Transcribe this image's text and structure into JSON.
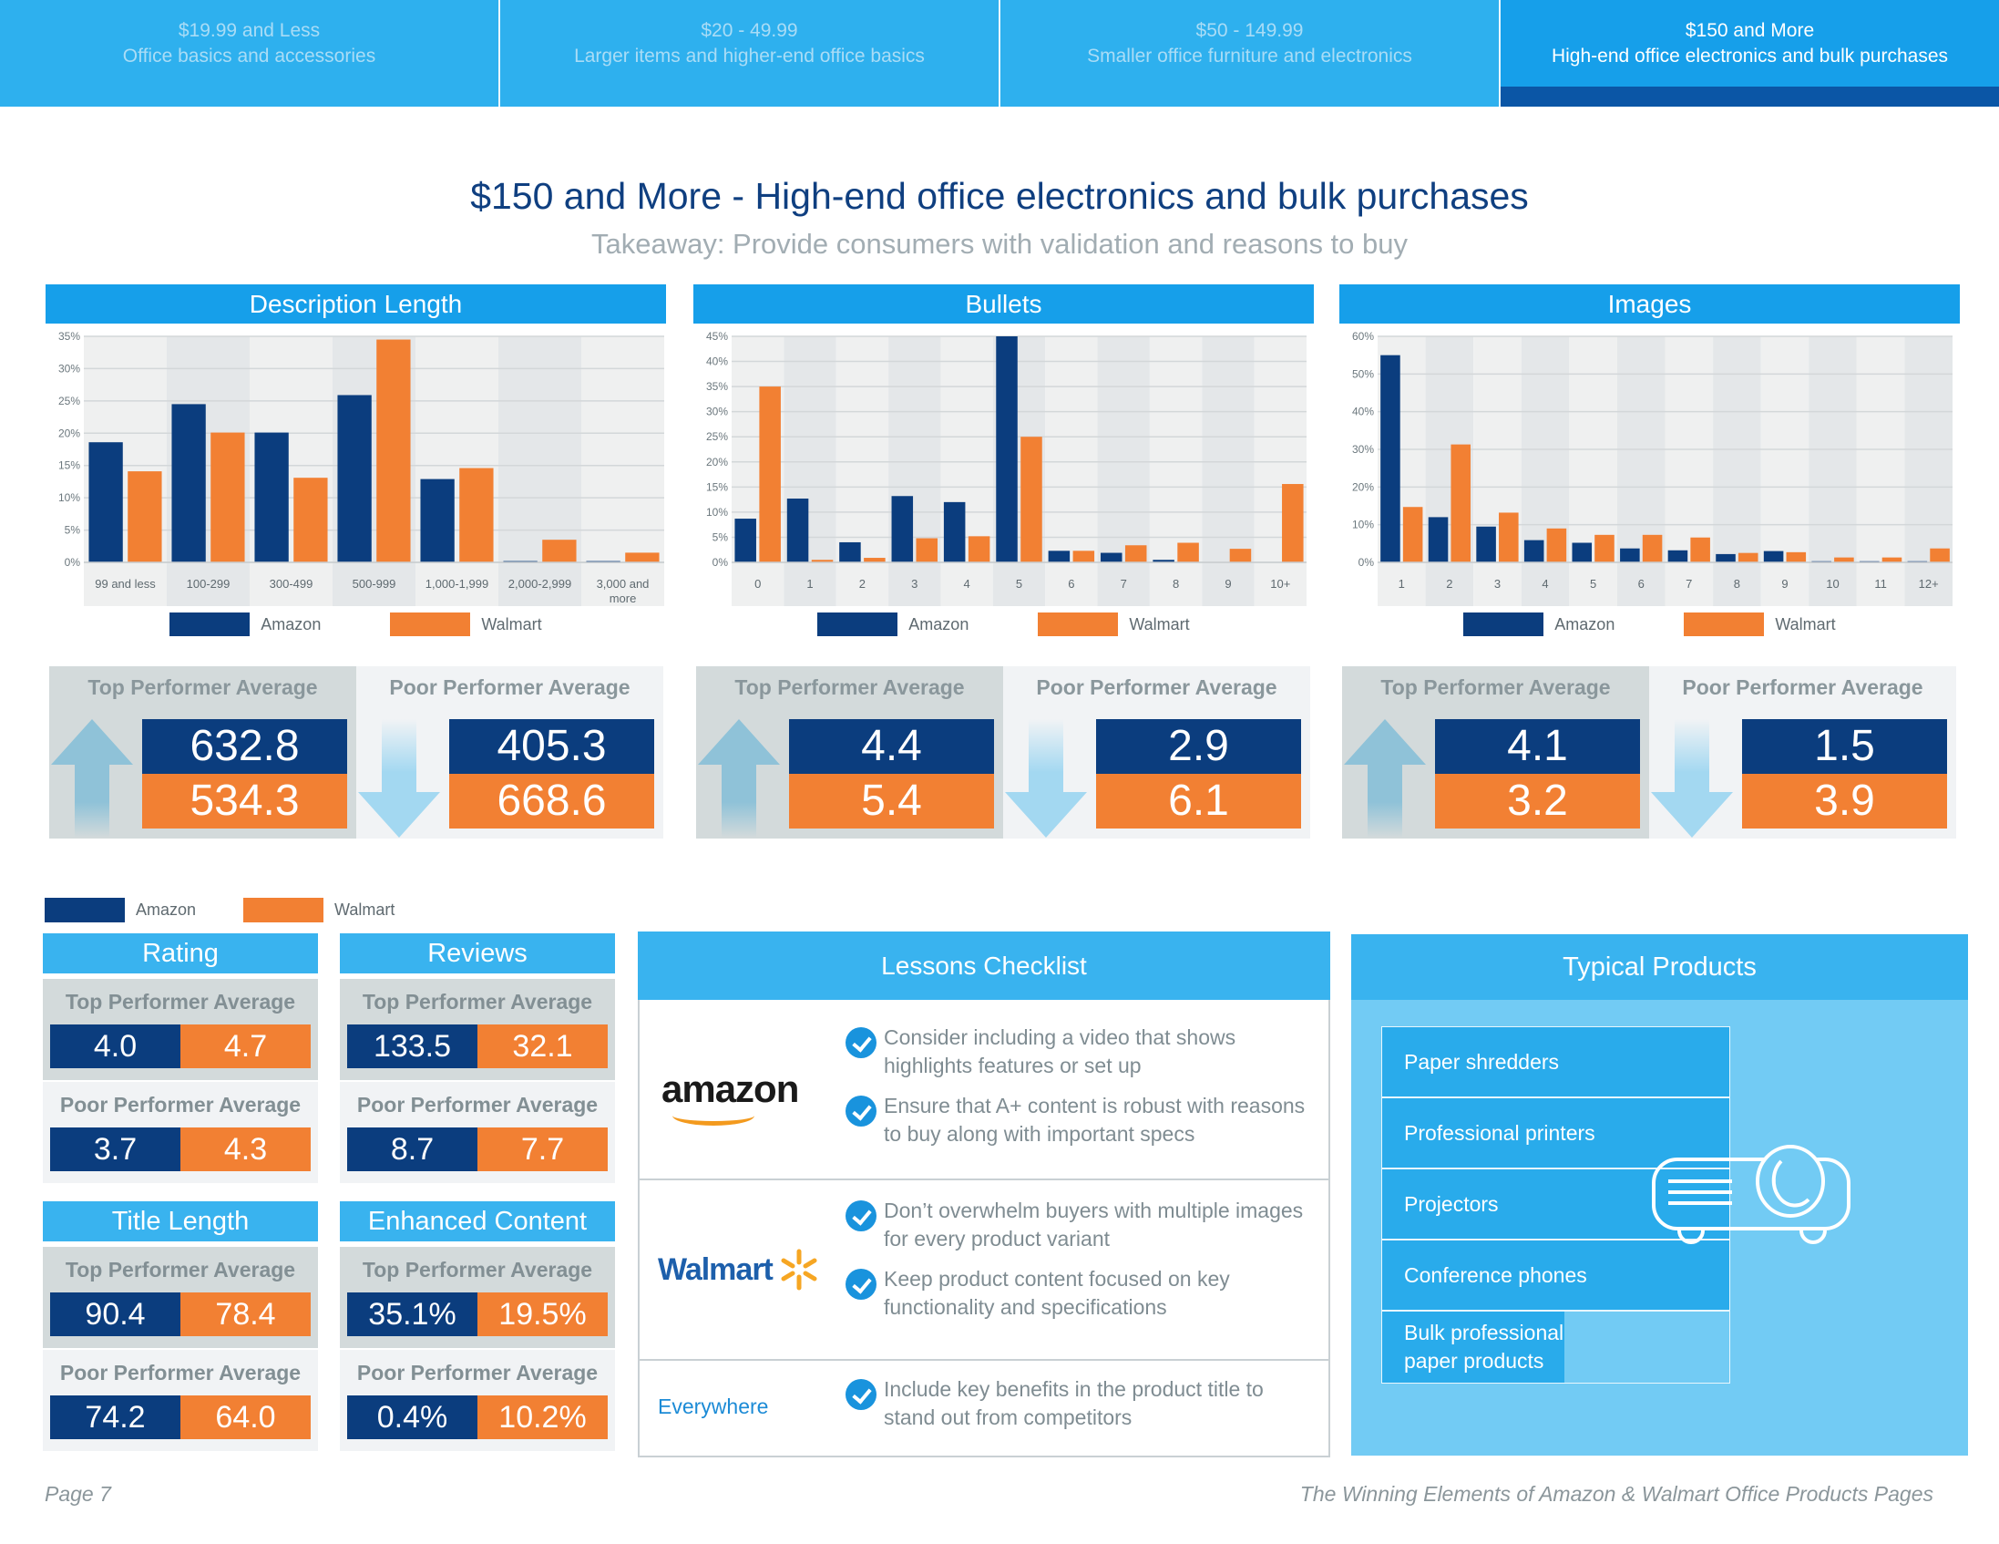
{
  "nav": {
    "tabs": [
      {
        "price": "$19.99 and Less",
        "desc": "Office basics and accessories",
        "active": false
      },
      {
        "price": "$20 - 49.99",
        "desc": "Larger items and higher-end office basics",
        "active": false
      },
      {
        "price": "$50 - 149.99",
        "desc": "Smaller office furniture and electronics",
        "active": false
      },
      {
        "price": "$150 and More",
        "desc": "High-end office electronics and bulk purchases",
        "active": true
      }
    ]
  },
  "header": {
    "title": "$150 and More - High-end office electronics and bulk purchases",
    "subtitle": "Takeaway: Provide consumers with validation and reasons to buy"
  },
  "colors": {
    "amazon": "#0b3d7e",
    "walmart": "#f28033",
    "accent": "#169fea"
  },
  "legend": {
    "amazon": "Amazon",
    "walmart": "Walmart"
  },
  "chart_data": [
    {
      "type": "bar",
      "title": "Description Length",
      "xlabel": "",
      "ylabel": "",
      "ylim": [
        0,
        35
      ],
      "yticks": [
        "0%",
        "5%",
        "10%",
        "15%",
        "20%",
        "25%",
        "30%",
        "35%"
      ],
      "ytick_values": [
        0,
        5,
        10,
        15,
        20,
        25,
        30,
        35
      ],
      "grid": true,
      "legend_position": "bottom",
      "categories": [
        "99 and less",
        "100-299",
        "300-499",
        "500-999",
        "1,000-1,999",
        "2,000-2,999",
        "3,000 and more"
      ],
      "series": [
        {
          "name": "Amazon",
          "values": [
            18.6,
            24.5,
            20.1,
            25.9,
            12.9,
            0.2,
            0.2
          ]
        },
        {
          "name": "Walmart",
          "values": [
            14.1,
            20.1,
            13.1,
            34.5,
            14.6,
            3.5,
            1.5
          ]
        }
      ]
    },
    {
      "type": "bar",
      "title": "Bullets",
      "xlabel": "",
      "ylabel": "",
      "ylim": [
        0,
        45
      ],
      "yticks": [
        "0%",
        "5%",
        "10%",
        "15%",
        "20%",
        "25%",
        "30%",
        "35%",
        "40%",
        "45%"
      ],
      "ytick_values": [
        0,
        5,
        10,
        15,
        20,
        25,
        30,
        35,
        40,
        45
      ],
      "grid": true,
      "legend_position": "bottom",
      "categories": [
        "0",
        "1",
        "2",
        "3",
        "4",
        "5",
        "6",
        "7",
        "8",
        "9",
        "10+"
      ],
      "series": [
        {
          "name": "Amazon",
          "values": [
            8.7,
            12.7,
            4.0,
            13.2,
            12.0,
            45.0,
            2.3,
            1.9,
            0.5,
            0.0,
            0.0
          ]
        },
        {
          "name": "Walmart",
          "values": [
            35.0,
            0.5,
            0.9,
            4.8,
            5.2,
            25.0,
            2.3,
            3.4,
            3.9,
            2.7,
            15.6
          ]
        }
      ]
    },
    {
      "type": "bar",
      "title": "Images",
      "xlabel": "",
      "ylabel": "",
      "ylim": [
        0,
        60
      ],
      "yticks": [
        "0%",
        "10%",
        "20%",
        "30%",
        "40%",
        "50%",
        "60%"
      ],
      "ytick_values": [
        0,
        10,
        20,
        30,
        40,
        50,
        60
      ],
      "grid": true,
      "legend_position": "bottom",
      "categories": [
        "1",
        "2",
        "3",
        "4",
        "5",
        "6",
        "7",
        "8",
        "9",
        "10",
        "11",
        "12+"
      ],
      "series": [
        {
          "name": "Amazon",
          "values": [
            55.0,
            12.0,
            9.5,
            5.9,
            5.2,
            3.7,
            3.2,
            2.2,
            3.0,
            0.3,
            0.3,
            0.3
          ]
        },
        {
          "name": "Walmart",
          "values": [
            14.7,
            31.3,
            13.2,
            9.0,
            7.3,
            7.3,
            6.6,
            2.5,
            2.7,
            1.3,
            1.3,
            3.7
          ]
        }
      ]
    }
  ],
  "chart_perf": [
    {
      "top_label": "Top Performer Average",
      "poor_label": "Poor Performer Average",
      "top_amazon": "632.8",
      "top_walmart": "534.3",
      "poor_amazon": "405.3",
      "poor_walmart": "668.6"
    },
    {
      "top_label": "Top Performer Average",
      "poor_label": "Poor Performer Average",
      "top_amazon": "4.4",
      "top_walmart": "5.4",
      "poor_amazon": "2.9",
      "poor_walmart": "6.1"
    },
    {
      "top_label": "Top Performer Average",
      "poor_label": "Poor Performer Average",
      "top_amazon": "4.1",
      "top_walmart": "3.2",
      "poor_amazon": "1.5",
      "poor_walmart": "3.9"
    }
  ],
  "metrics": [
    {
      "title": "Rating",
      "top_label": "Top Performer Average",
      "poor_label": "Poor Performer Average",
      "top_amazon": "4.0",
      "top_walmart": "4.7",
      "poor_amazon": "3.7",
      "poor_walmart": "4.3"
    },
    {
      "title": "Reviews",
      "top_label": "Top Performer Average",
      "poor_label": "Poor Performer Average",
      "top_amazon": "133.5",
      "top_walmart": "32.1",
      "poor_amazon": "8.7",
      "poor_walmart": "7.7"
    },
    {
      "title": "Title Length",
      "top_label": "Top Performer Average",
      "poor_label": "Poor Performer Average",
      "top_amazon": "90.4",
      "top_walmart": "78.4",
      "poor_amazon": "74.2",
      "poor_walmart": "64.0"
    },
    {
      "title": "Enhanced Content",
      "top_label": "Top Performer Average",
      "poor_label": "Poor Performer Average",
      "top_amazon": "35.1%",
      "top_walmart": "19.5%",
      "poor_amazon": "0.4%",
      "poor_walmart": "10.2%"
    }
  ],
  "lessons": {
    "title": "Lessons Checklist",
    "groups": [
      {
        "brand": "amazon",
        "items": [
          "Consider including a video that shows highlights features or set up",
          "Ensure that A+ content is robust with reasons to buy along with important specs"
        ]
      },
      {
        "brand": "Walmart",
        "items": [
          "Don’t overwhelm buyers with multiple images for every product variant",
          "Keep product content focused on key functionality and specifications"
        ]
      },
      {
        "brand": "Everywhere",
        "items": [
          "Include key benefits in the product title to stand out from competitors"
        ]
      }
    ]
  },
  "typical": {
    "title": "Typical Products",
    "items": [
      "Paper shredders",
      "Professional printers",
      "Projectors",
      "Conference phones",
      "Bulk professional paper products"
    ]
  },
  "footer": {
    "page": "Page 7",
    "doc_title": "The Winning Elements of Amazon & Walmart Office Products Pages"
  }
}
